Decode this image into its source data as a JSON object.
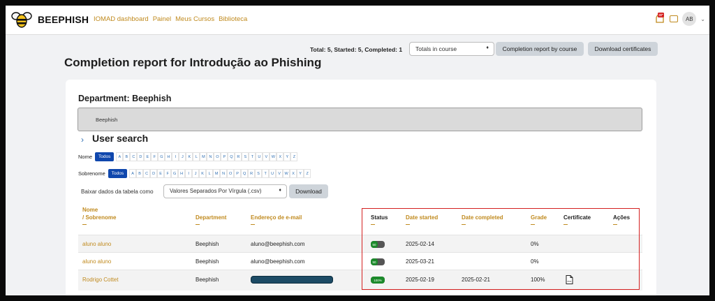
{
  "navbar": {
    "brand": "BEEPHISH",
    "links": [
      "IOMAD dashboard",
      "Painel",
      "Meus Cursos",
      "Biblioteca"
    ],
    "avatar_initials": "AB",
    "icons": [
      "bee-logo-icon",
      "notification-bell-icon",
      "chat-icon",
      "chevron-down-icon"
    ]
  },
  "toolbar": {
    "totals": "Total: 5, Started: 5, Completed: 1",
    "select_value": "Totals in course",
    "btn_by_course": "Completion report by course",
    "btn_download_certs": "Download certificates"
  },
  "page_title": "Completion report for Introdução ao Phishing",
  "department": {
    "title": "Department: Beephish",
    "value": "Beephish"
  },
  "user_search": {
    "title": "User search",
    "first_label": "Nome",
    "last_label": "Sobrenome",
    "all_label": "Todos",
    "letters": [
      "A",
      "B",
      "C",
      "D",
      "E",
      "F",
      "G",
      "H",
      "I",
      "J",
      "K",
      "L",
      "M",
      "N",
      "O",
      "P",
      "Q",
      "R",
      "S",
      "T",
      "U",
      "V",
      "W",
      "X",
      "Y",
      "Z"
    ]
  },
  "download": {
    "label": "Baixar dados da tabela como",
    "format": "Valores Separados Por Vírgula (.csv)",
    "button": "Download"
  },
  "table": {
    "headers": {
      "nome": "Nome",
      "sobrenome": "/ Sobrenome",
      "department": "Department",
      "email": "Endereço de e-mail",
      "status": "Status",
      "date_started": "Date started",
      "date_completed": "Date completed",
      "grade": "Grade",
      "certificate": "Certificate",
      "acoes": "Ações"
    },
    "rows": [
      {
        "name": "aluno aluno",
        "department": "Beephish",
        "email": "aluno@beephish.com",
        "status_label": "50",
        "status_pct": 0.5,
        "date_started": "2025-02-14",
        "date_completed": "",
        "grade": "0%"
      },
      {
        "name": "aluno aluno",
        "department": "Beephish",
        "email": "aluno@beephish.com",
        "status_label": "50",
        "status_pct": 0.5,
        "date_started": "2025-03-21",
        "date_completed": "",
        "grade": "0%"
      },
      {
        "name": "Rodrigo Cottet",
        "department": "Beephish",
        "email": "",
        "status_label": "100%",
        "status_pct": 1.0,
        "date_started": "2025-02-19",
        "date_completed": "2025-02-21",
        "grade": "100%",
        "certificate_icon": "pdf-icon",
        "certificate_label": "PDF"
      }
    ]
  },
  "colors": {
    "accent": "#c08a1e",
    "link_blue": "#2f6fb3",
    "todos_bg": "#0f47ad",
    "progress_green": "#1c8a2b",
    "highlight_red": "#d42020"
  }
}
